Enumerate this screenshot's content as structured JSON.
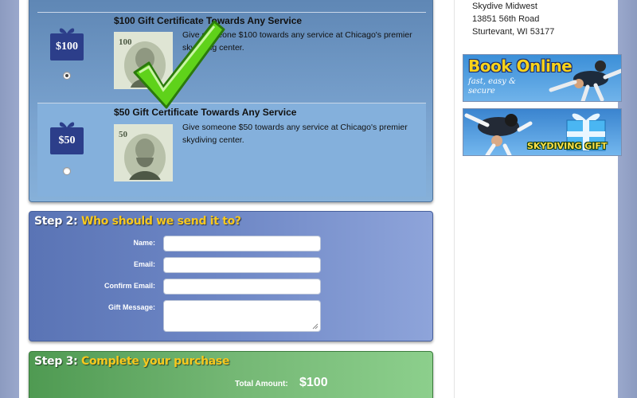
{
  "step1": {
    "options": [
      {
        "badge": "$100",
        "title": "$100 Gift Certificate Towards Any Service",
        "description": "Give someone $100 towards any service at Chicago's premier skydiving center.",
        "selected": true
      },
      {
        "badge": "$50",
        "title": "$50 Gift Certificate Towards Any Service",
        "description": "Give someone $50 towards any service at Chicago's premier skydiving center.",
        "selected": false
      }
    ]
  },
  "step2": {
    "heading_num": "Step 2:",
    "heading_text": "Who should we send it to?",
    "fields": {
      "name_label": "Name:",
      "email_label": "Email:",
      "confirm_email_label": "Confirm Email:",
      "gift_message_label": "Gift Message:"
    }
  },
  "step3": {
    "heading_num": "Step 3:",
    "heading_text": "Complete your purchase",
    "total_label": "Total Amount:",
    "total_value": "$100"
  },
  "sidebar": {
    "address_line1": "Skydive Midwest",
    "address_line2": "13851 56th Road",
    "address_line3": "Sturtevant, WI 53177",
    "promo1_title": "Book Online",
    "promo1_sub": "fast, easy & secure",
    "promo2_title": "SKYDIVING GIFT"
  },
  "colors": {
    "step1_bg": "#7aa3cf",
    "step2_bg": "#6f88c6",
    "step3_bg": "#74b774",
    "heading_accent": "#f7c81e",
    "badge_blue": "#2c3e8a",
    "checkmark_green": "#5fd21a"
  },
  "icons": [
    "gift-bow-icon",
    "checkmark-icon",
    "dollar-bill-image",
    "resize-grip-icon"
  ]
}
